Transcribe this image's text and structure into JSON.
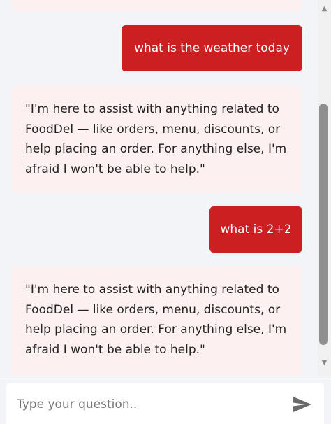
{
  "messages": [
    {
      "role": "bot",
      "text": ""
    },
    {
      "role": "user",
      "text": "what is the weather today"
    },
    {
      "role": "bot",
      "text": "\"I'm here to assist with anything related to FoodDel — like orders, menu, discounts, or help placing an order. For anything else, I'm afraid I won't be able to help.\""
    },
    {
      "role": "user",
      "text": "what is 2+2"
    },
    {
      "role": "bot",
      "text": "\"I'm here to assist with anything related to FoodDel — like orders, menu, discounts, or help placing an order. For anything else, I'm afraid I won't be able to help.\""
    }
  ],
  "input": {
    "placeholder": "Type your question..",
    "value": ""
  },
  "icons": {
    "send": "send-icon",
    "scroll_up": "scroll-up-arrow-icon",
    "scroll_down": "scroll-down-arrow-icon"
  },
  "colors": {
    "user_bubble": "#cc1f22",
    "bot_bubble": "#fdf0f0",
    "background": "#f3f4f8"
  }
}
